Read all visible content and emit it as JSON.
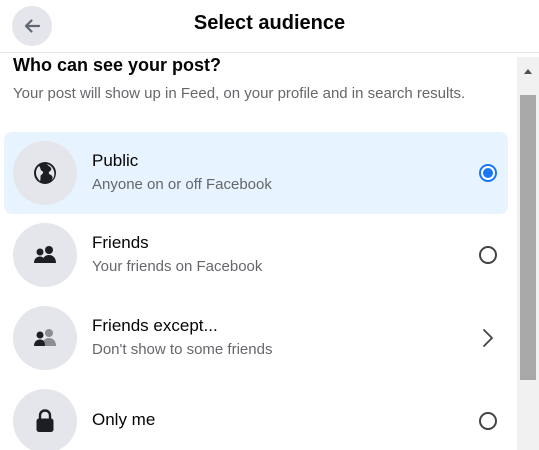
{
  "header": {
    "title": "Select audience",
    "back_icon": "arrow-left-icon"
  },
  "section": {
    "heading": "Who can see your post?",
    "subtext": "Your post will show up in Feed, on your profile and in search results."
  },
  "options": [
    {
      "title": "Public",
      "description": "Anyone on or off Facebook",
      "icon": "globe-icon",
      "control": "radio",
      "selected": true
    },
    {
      "title": "Friends",
      "description": "Your friends on Facebook",
      "icon": "friends-icon",
      "control": "radio",
      "selected": false
    },
    {
      "title": "Friends except...",
      "description": "Don't show to some friends",
      "icon": "friends-except-icon",
      "control": "chevron",
      "selected": false
    },
    {
      "title": "Only me",
      "description": "",
      "icon": "lock-icon",
      "control": "radio",
      "selected": false
    }
  ],
  "colors": {
    "accent": "#1877f2",
    "selected_bg": "#e7f3ff",
    "icon_circle": "#e4e6eb",
    "secondary_text": "#65676b"
  }
}
